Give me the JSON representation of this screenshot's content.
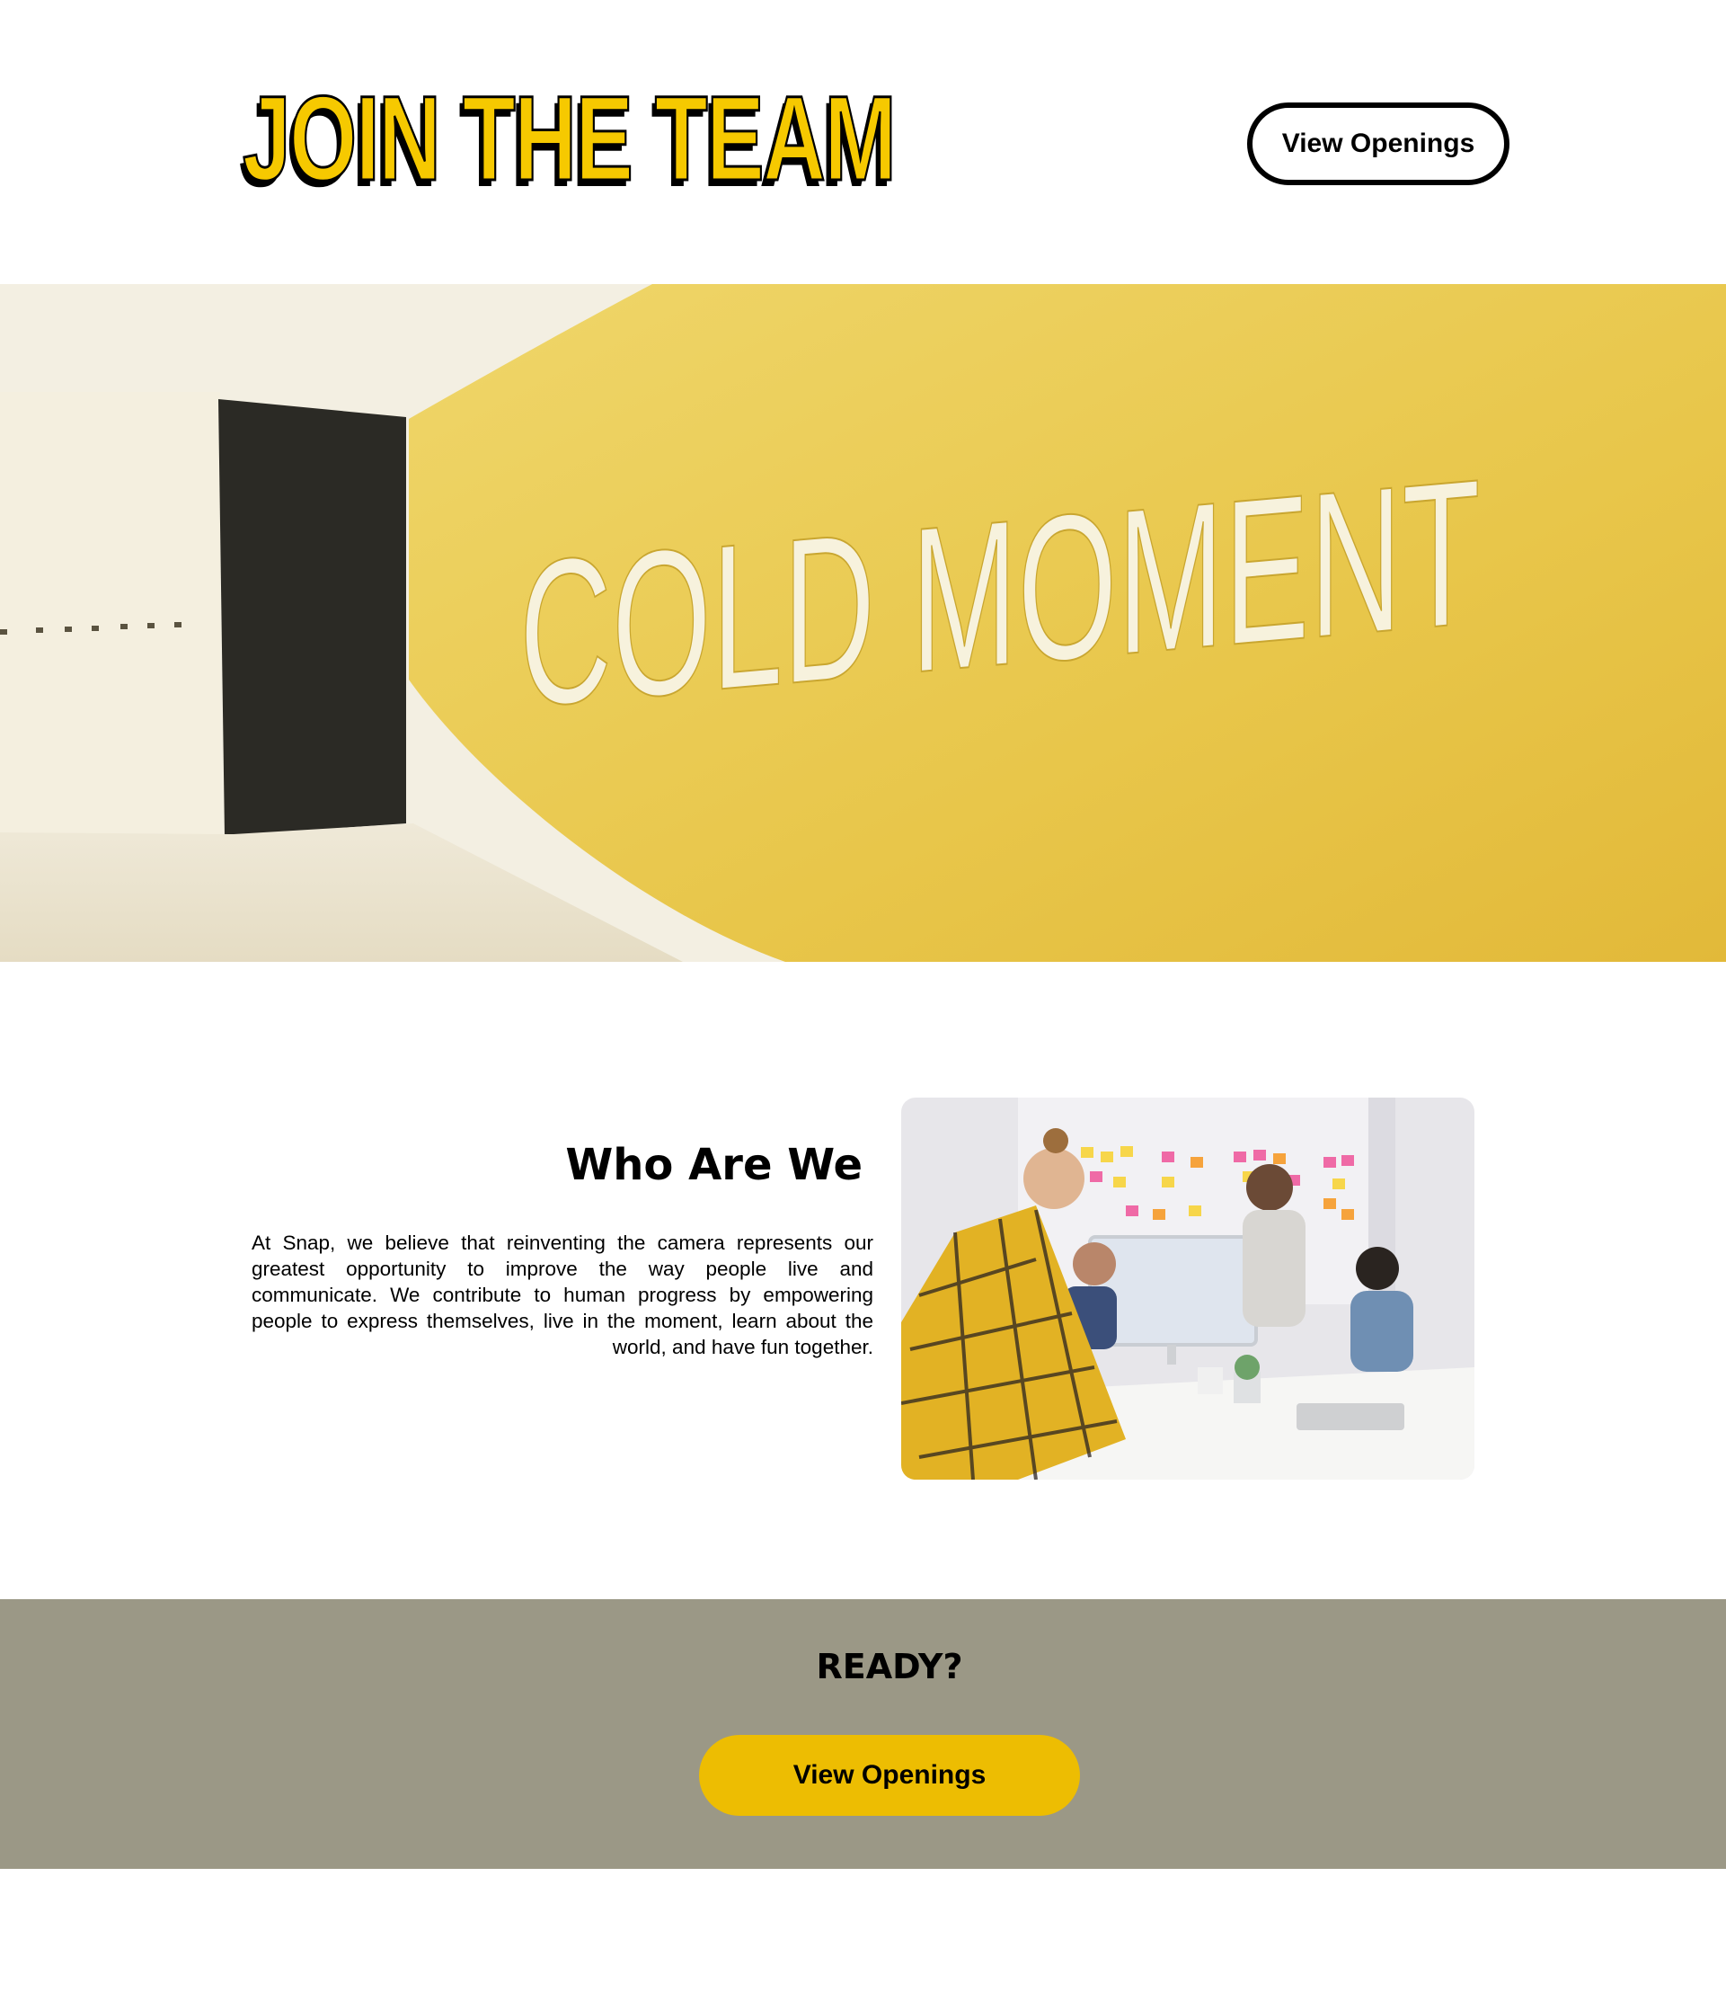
{
  "header": {
    "title": "JOIN THE TEAM",
    "cta_label": "View Openings"
  },
  "hero": {
    "wall_sign_text": "COLD MOMENT"
  },
  "about": {
    "title": "Who Are We",
    "body": "At Snap, we believe that reinventing the camera represents our greatest opportunity to improve the way people live and communicate. We contribute to human progress by empowering people to express themselves, live in the moment, learn about the world, and have fun together."
  },
  "ready": {
    "title": "READY?",
    "cta_label": "View Openings"
  },
  "colors": {
    "brand_yellow": "#f6c900",
    "cta_yellow": "#edbd02",
    "band_gray": "#9b9886",
    "wall_yellow": "#e9c546"
  }
}
